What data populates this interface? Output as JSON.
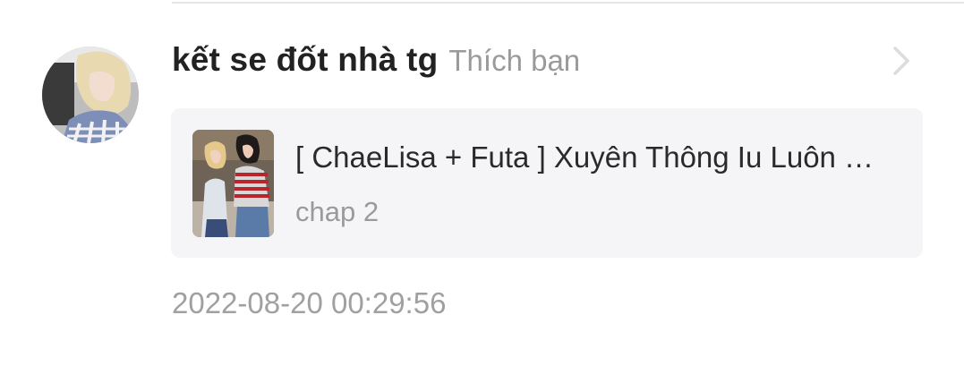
{
  "notification": {
    "username": "kết se đốt nhà tg",
    "action": "Thích bạn",
    "timestamp": "2022-08-20 00:29:56",
    "story": {
      "title": "[ ChaeLisa + Futa ] Xuyên Thông Iu Luôn …",
      "chapter": "chap 2"
    }
  },
  "icons": {
    "forward": "chevron-right-icon",
    "avatar": "user-avatar-image",
    "cover": "story-cover-image"
  },
  "colors": {
    "username": "#222222",
    "muted": "#9a9a9a",
    "card_background": "#f5f5f7",
    "divider": "#e6e6e6"
  }
}
